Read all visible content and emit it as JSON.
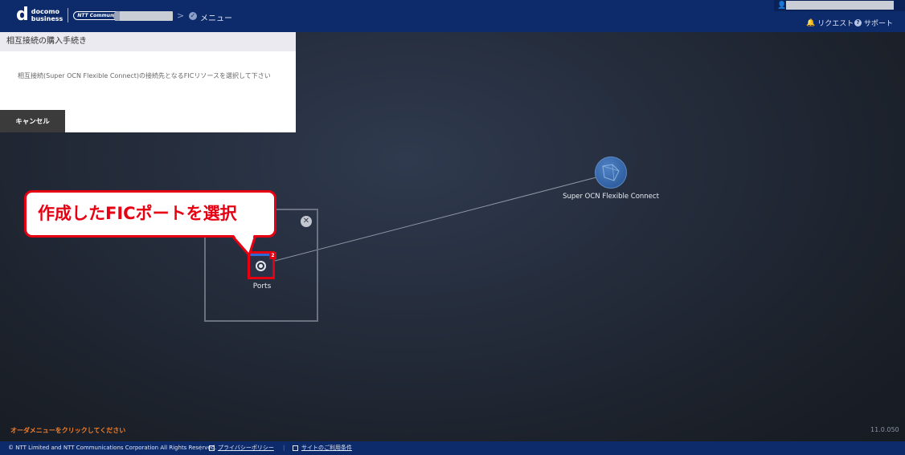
{
  "header": {
    "logo_line1": "docomo",
    "logo_line2": "business",
    "ntt_logo": "NTT Communications",
    "breadcrumb_menu": "メニュー",
    "request_label": "リクエスト",
    "support_label": "サポート"
  },
  "panel": {
    "title": "相互接続の購入手続き",
    "description": "相互接続(Super OCN Flexible Connect)の接続先となるFICリソースを選択して下さい",
    "cancel_label": "キャンセル"
  },
  "canvas": {
    "port_label": "Ports",
    "port_badge": "2",
    "service_label": "Super OCN Flexible Connect",
    "callout_text": "作成したFICポートを選択"
  },
  "bottom": {
    "order_hint": "オーダメニューをクリックしてください",
    "version": "11.0.050"
  },
  "footer": {
    "copyright": "© NTT Limited and NTT Communications Corporation All Rights Reserved.",
    "privacy_label": "プライバシーポリシー",
    "terms_label": "サイトのご利用条件"
  },
  "colors": {
    "header_bg": "#0d2a6b",
    "highlight_red": "#e60012",
    "hint_orange": "#f08030"
  }
}
